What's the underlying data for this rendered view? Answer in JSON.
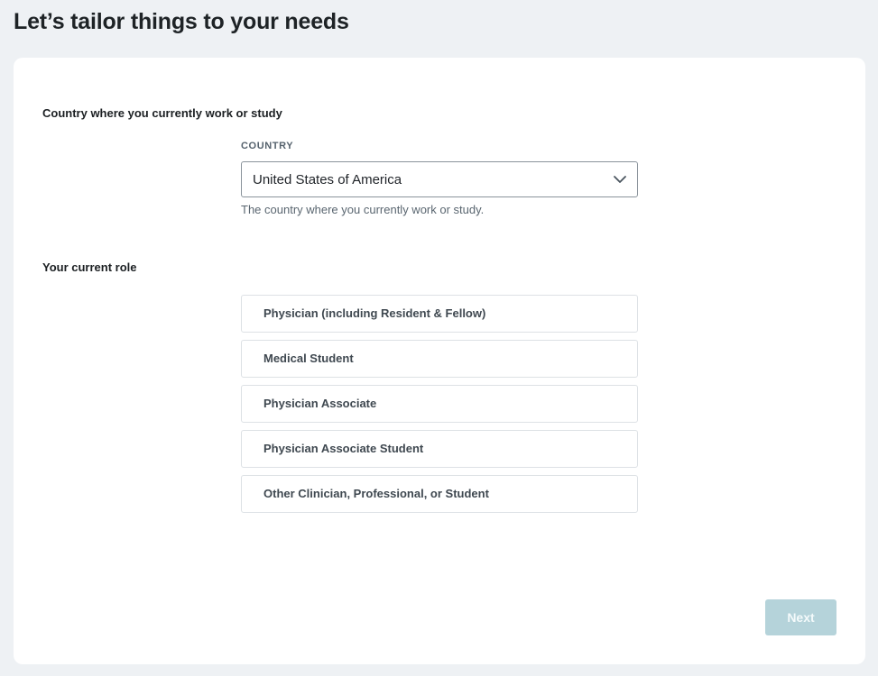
{
  "header": {
    "title": "Let’s tailor things to your needs"
  },
  "country_section": {
    "label": "Country where you currently work or study",
    "field_caption": "COUNTRY",
    "selected_value": "United States of America",
    "helper": "The country where you currently work or study.",
    "dropdown_icon": "chevron-down-icon"
  },
  "role_section": {
    "label": "Your current role",
    "options": [
      {
        "label": "Physician (including Resident & Fellow)"
      },
      {
        "label": "Medical Student"
      },
      {
        "label": "Physician Associate"
      },
      {
        "label": "Physician Associate Student"
      },
      {
        "label": "Other Clinician, Professional, or Student"
      }
    ]
  },
  "footer": {
    "next_label": "Next",
    "next_color": "#b5d3da"
  }
}
